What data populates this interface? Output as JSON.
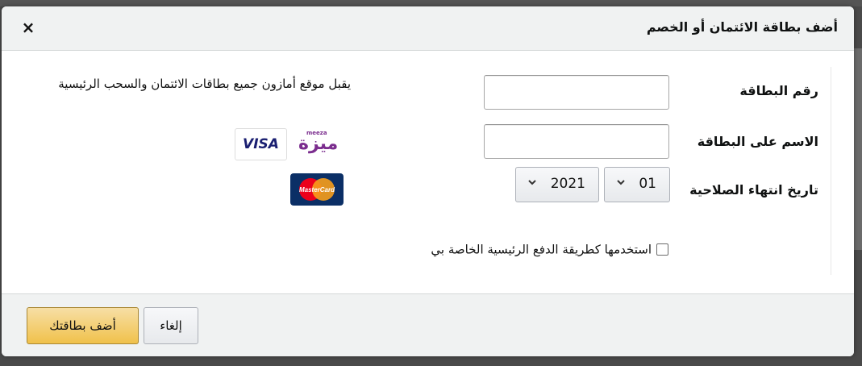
{
  "modal": {
    "title": "أضف بطاقة الائتمان أو الخصم",
    "close_label": "×"
  },
  "form": {
    "card_number_label": "رقم البطاقة",
    "card_name_label": "الاسم على البطاقة",
    "expiry_label": "تاريخ انتهاء الصلاحية",
    "expiry_month": "01",
    "expiry_year": "2021",
    "checkbox_label": "استخدمها كطريقة الدفع الرئيسية الخاصة بي",
    "checkbox_checked": false
  },
  "info": {
    "accepted_cards_text": "يقبل موقع أمازون جميع بطاقات الائتمان والسحب الرئيسية",
    "logos": [
      "meeza",
      "visa",
      "mastercard"
    ],
    "visa_text": "VISA",
    "meeza_brand": "meeza",
    "meeza_arabic": "ميزة",
    "mastercard_text": "MasterCard"
  },
  "footer": {
    "cancel_label": "إلغاء",
    "add_card_label": "أضف بطاقتك"
  },
  "colors": {
    "primary_button": "#f0c14b",
    "header_bg": "#f0f2f2",
    "overlay": "#3a3a3a"
  }
}
